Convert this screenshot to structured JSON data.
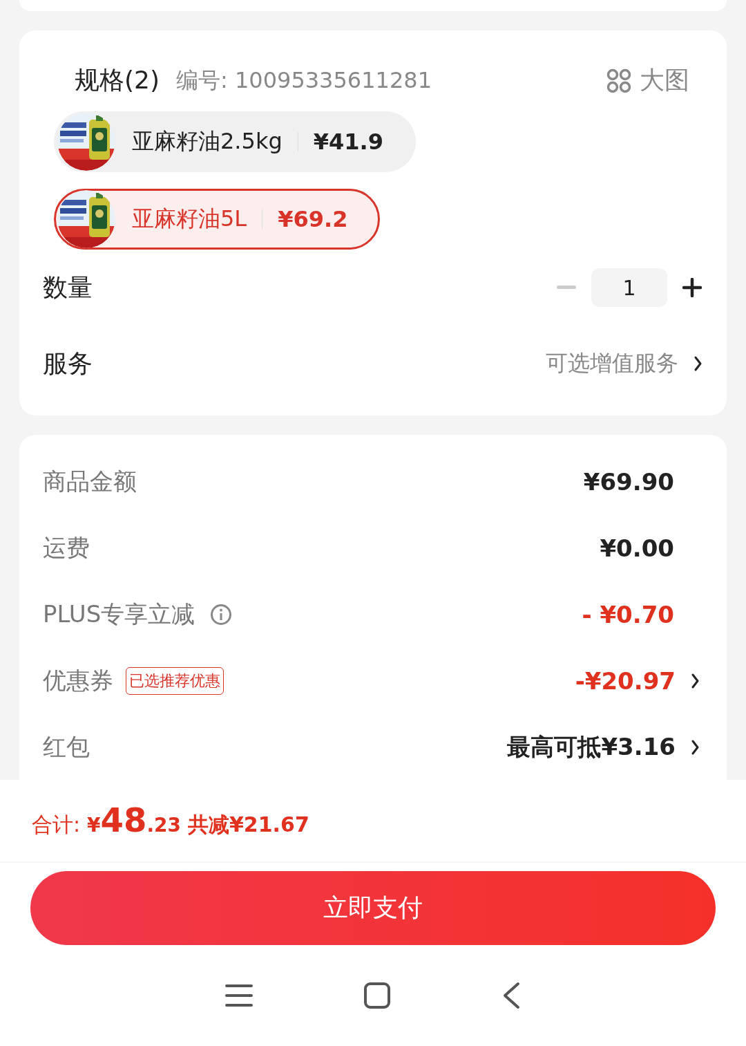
{
  "spec": {
    "title": "规格(2)",
    "code": "编号: 10095335611281",
    "big_image": "大图",
    "options": [
      {
        "name": "亚麻籽油2.5kg",
        "price": "¥41.9",
        "selected": false
      },
      {
        "name": "亚麻籽油5L",
        "price": "¥69.2",
        "selected": true
      }
    ]
  },
  "quantity": {
    "label": "数量",
    "value": "1",
    "minus_disabled": true
  },
  "service": {
    "label": "服务",
    "value": "可选增值服务"
  },
  "price_rows": [
    {
      "label": "商品金额",
      "value": "¥69.90",
      "kind": "plain",
      "info": false,
      "arrow": false
    },
    {
      "label": "运费",
      "value": "¥0.00",
      "kind": "plain",
      "info": false,
      "arrow": false
    },
    {
      "label": "PLUS专享立减",
      "value": "- ¥0.70",
      "kind": "discount",
      "info": true,
      "arrow": false
    },
    {
      "label": "优惠券",
      "tag": "已选推荐优惠",
      "value": "-¥20.97",
      "kind": "discount",
      "info": false,
      "arrow": true
    },
    {
      "label": "红包",
      "value": "最高可抵¥3.16",
      "kind": "plain",
      "info": false,
      "arrow": true
    }
  ],
  "footer": {
    "total_label": "合计:",
    "currency": "¥",
    "total_integer": "48",
    "total_decimal": ".23",
    "saved": "共减¥21.67",
    "pay_button": "立即支付"
  }
}
